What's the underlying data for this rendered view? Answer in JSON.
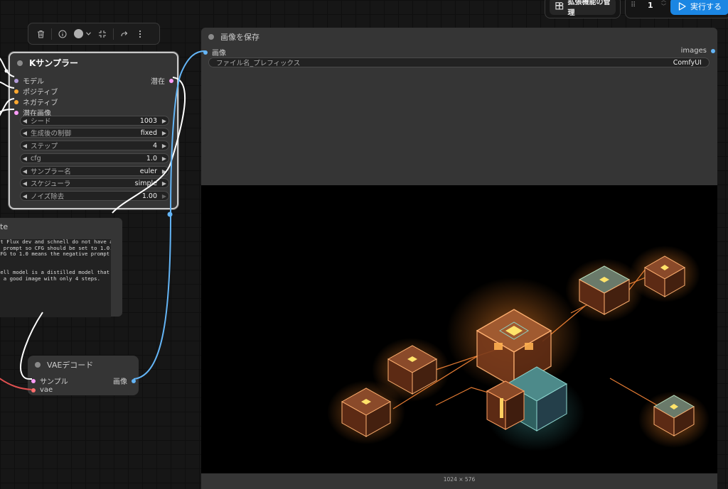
{
  "header": {
    "extensions_label": "拡張機能の管理",
    "queue_count": "1",
    "run_label": "実行する"
  },
  "toolbar": {
    "icons": [
      "trash-icon",
      "info-icon",
      "color-icon",
      "fit-icon",
      "redo-icon",
      "more-icon"
    ]
  },
  "ksampler": {
    "title": "Kサンプラー",
    "inputs": [
      "モデル",
      "ポジティブ",
      "ネガティブ",
      "潜在画像"
    ],
    "output": "潜在",
    "widgets": [
      {
        "label": "シード",
        "value": "1003"
      },
      {
        "label": "生成後の制御",
        "value": "fixed"
      },
      {
        "label": "ステップ",
        "value": "4"
      },
      {
        "label": "cfg",
        "value": "1.0"
      },
      {
        "label": "サンプラー名",
        "value": "euler"
      },
      {
        "label": "スケジューラ",
        "value": "simple"
      },
      {
        "label": "ノイズ除去",
        "value": "1.00"
      }
    ]
  },
  "note": {
    "title": "te",
    "text": "at Flux dev and schnell do not have any\ne prompt so CFG should be set to 1.0.\nCFG to 1.0 means the negative prompt is\n.\n\nnell model is a distilled model that can\ne a good image with only 4 steps."
  },
  "vae_decode": {
    "title": "VAEデコード",
    "inputs": [
      "サンプル",
      "vae"
    ],
    "output": "画像"
  },
  "save_image": {
    "title": "画像を保存",
    "input": "画像",
    "output": "images",
    "filename_label": "ファイル名_プレフィックス",
    "filename_value": "ComfyUI",
    "dimensions": "1024 × 576"
  },
  "colors": {
    "model": "#b39ddb",
    "conditioning": "#ffa931",
    "latent": "#ff9cf9",
    "image": "#64b5f6",
    "vae": "#ff6e6e",
    "accent": "#1b86e3"
  }
}
